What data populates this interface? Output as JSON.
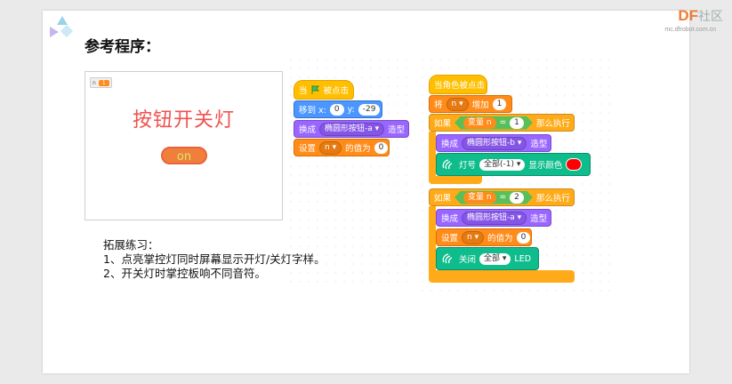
{
  "watermark": {
    "brand": "DF",
    "rest": "社区",
    "url": "mc.dfrobot.com.cn"
  },
  "slide": {
    "title": "参考程序："
  },
  "stage": {
    "var_name": "n",
    "var_value": "1",
    "title": "按钮开关灯",
    "button_label": "on"
  },
  "exercise": {
    "heading": "拓展练习：",
    "items": [
      "1、点亮掌控灯同时屏幕显示开灯/关灯字样。",
      "2、开关灯时掌控板响不同音符。"
    ]
  },
  "script1": {
    "hat_label_pre": "当",
    "hat_label_post": "被点击",
    "goto_label": "移到 x:",
    "goto_x": "0",
    "goto_y_label": "y:",
    "goto_y": "-29",
    "costume_label": "换成",
    "costume_value": "椭圆形按钮-a ▾",
    "costume_suffix": "造型",
    "set_label": "设置",
    "set_var": "n ▾",
    "set_mid": "的值为",
    "set_value": "0"
  },
  "script2": {
    "hat_label": "当角色被点击",
    "change_label": "将",
    "change_var": "n ▾",
    "change_mid": "增加",
    "change_value": "1",
    "if1_label": "如果",
    "if1_var": "变量",
    "if1_var_name": "n",
    "if1_eq": "=",
    "if1_value": "1",
    "if1_then": "那么执行",
    "costume1_label": "换成",
    "costume1_value": "椭圆形按钮-b ▾",
    "costume1_suffix": "造型",
    "led_label": "灯号",
    "led_value": "全部(-1) ▾",
    "led_suffix": "显示颜色",
    "led_color": "#ff0000",
    "if2_label": "如果",
    "if2_var": "变量",
    "if2_var_name": "n",
    "if2_eq": "=",
    "if2_value": "2",
    "if2_then": "那么执行",
    "costume2_label": "换成",
    "costume2_value": "椭圆形按钮-a ▾",
    "costume2_suffix": "造型",
    "set_label": "设置",
    "set_var": "n ▾",
    "set_mid": "的值为",
    "set_value": "0",
    "off_label": "关闭",
    "off_value": "全部 ▾",
    "off_suffix": "LED"
  }
}
